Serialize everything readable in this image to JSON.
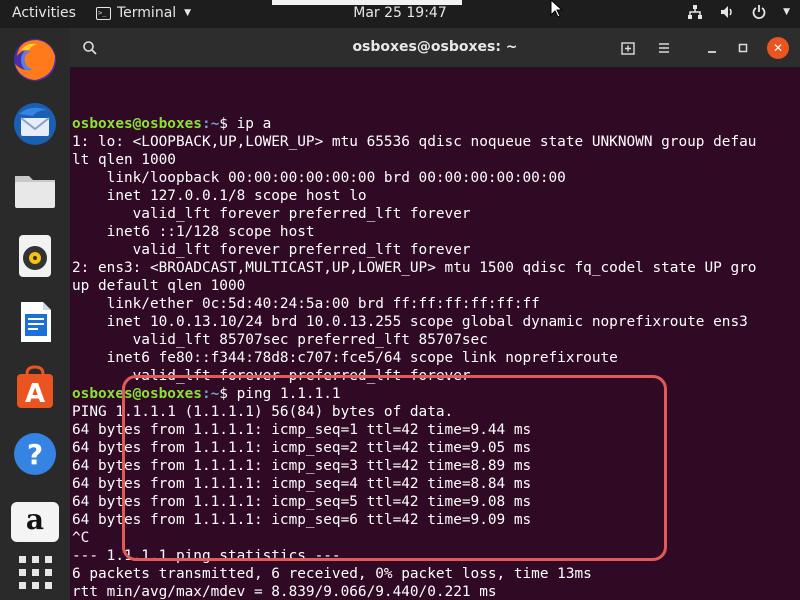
{
  "topbar": {
    "activities": "Activities",
    "app_name": "Terminal",
    "clock": "Mar 25  19:47"
  },
  "window": {
    "title": "osboxes@osboxes: ~"
  },
  "prompt": {
    "user_host": "osboxes@osboxes",
    "path": ":~",
    "symbol": "$ "
  },
  "terminal_lines": [
    {
      "cmd": "ip a"
    },
    {
      "out": "1: lo: <LOOPBACK,UP,LOWER_UP> mtu 65536 qdisc noqueue state UNKNOWN group defau"
    },
    {
      "out": "lt qlen 1000"
    },
    {
      "out": "    link/loopback 00:00:00:00:00:00 brd 00:00:00:00:00:00"
    },
    {
      "out": "    inet 127.0.0.1/8 scope host lo"
    },
    {
      "out": "       valid_lft forever preferred_lft forever"
    },
    {
      "out": "    inet6 ::1/128 scope host"
    },
    {
      "out": "       valid_lft forever preferred_lft forever"
    },
    {
      "out": "2: ens3: <BROADCAST,MULTICAST,UP,LOWER_UP> mtu 1500 qdisc fq_codel state UP gro"
    },
    {
      "out": "up default qlen 1000"
    },
    {
      "out": "    link/ether 0c:5d:40:24:5a:00 brd ff:ff:ff:ff:ff:ff"
    },
    {
      "out": "    inet 10.0.13.10/24 brd 10.0.13.255 scope global dynamic noprefixroute ens3"
    },
    {
      "out": "       valid_lft 85707sec preferred_lft 85707sec"
    },
    {
      "out": "    inet6 fe80::f344:78d8:c707:fce5/64 scope link noprefixroute"
    },
    {
      "out": "       valid_lft forever preferred_lft forever"
    },
    {
      "cmd": "ping 1.1.1.1"
    },
    {
      "out": "PING 1.1.1.1 (1.1.1.1) 56(84) bytes of data."
    },
    {
      "out": "64 bytes from 1.1.1.1: icmp_seq=1 ttl=42 time=9.44 ms"
    },
    {
      "out": "64 bytes from 1.1.1.1: icmp_seq=2 ttl=42 time=9.05 ms"
    },
    {
      "out": "64 bytes from 1.1.1.1: icmp_seq=3 ttl=42 time=8.89 ms"
    },
    {
      "out": "64 bytes from 1.1.1.1: icmp_seq=4 ttl=42 time=8.84 ms"
    },
    {
      "out": "64 bytes from 1.1.1.1: icmp_seq=5 ttl=42 time=9.08 ms"
    },
    {
      "out": "64 bytes from 1.1.1.1: icmp_seq=6 ttl=42 time=9.09 ms"
    },
    {
      "out": "^C"
    },
    {
      "out": "--- 1.1.1.1 ping statistics ---"
    },
    {
      "out": "6 packets transmitted, 6 received, 0% packet loss, time 13ms"
    },
    {
      "out": "rtt min/avg/max/mdev = 8.839/9.066/9.440/0.221 ms"
    },
    {
      "cmd": ""
    }
  ],
  "dock": {
    "amazon_letter": "a"
  },
  "colors": {
    "terminal_bg": "#300a24",
    "prompt_user": "#8ae234",
    "prompt_path": "#729fcf",
    "close_button": "#e95420",
    "highlight_border": "#e05a5a"
  }
}
